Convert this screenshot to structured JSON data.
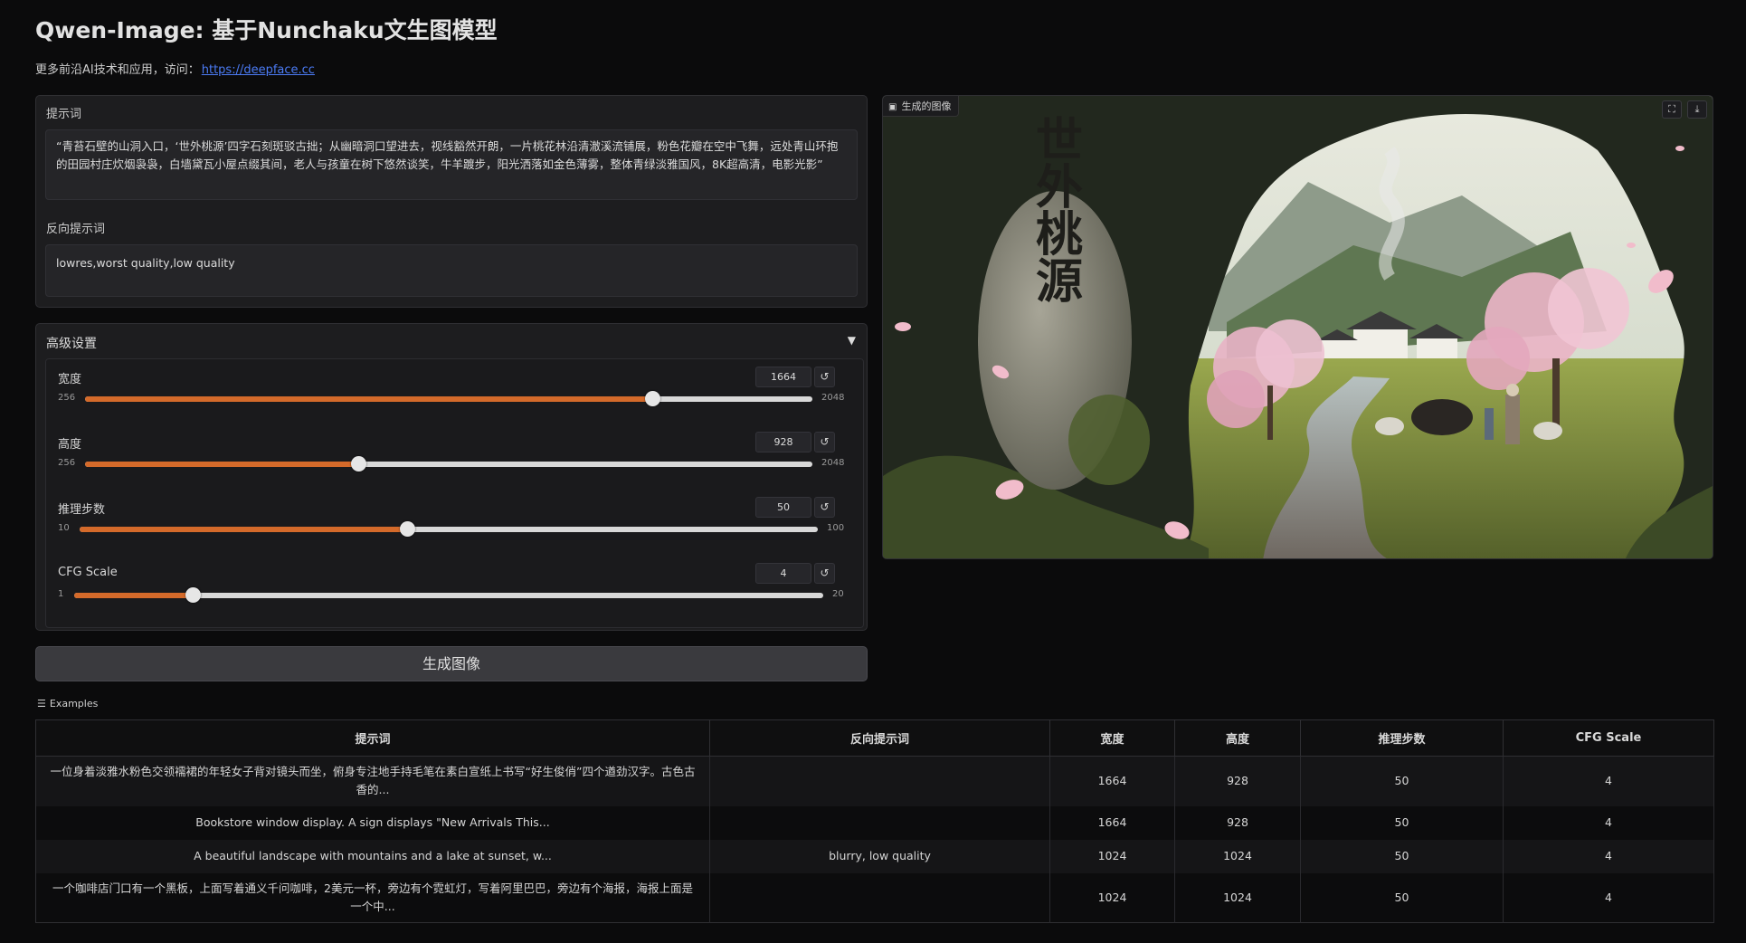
{
  "header": {
    "title": "Qwen-Image: 基于Nunchaku文生图模型",
    "subtitle_prefix": "更多前沿AI技术和应用，访问：",
    "link_text": "https://deepface.cc"
  },
  "prompt": {
    "label": "提示词",
    "value": "“青苔石壁的山洞入口，‘世外桃源’四字石刻斑驳古拙；从幽暗洞口望进去，视线豁然开朗，一片桃花林沿清澈溪流铺展，粉色花瓣在空中飞舞，远处青山环抱的田园村庄炊烟袅袅，白墙黛瓦小屋点缀其间，老人与孩童在树下悠然谈笑，牛羊踱步，阳光洒落如金色薄雾，整体青绿淡雅国风，8K超高清，电影光影”"
  },
  "negative_prompt": {
    "label": "反向提示词",
    "value": "lowres,worst quality,low quality"
  },
  "advanced": {
    "label": "高级设置",
    "caret": "▼",
    "sliders": [
      {
        "label": "宽度",
        "value": "1664",
        "min": "256",
        "max": "2048",
        "fraction": 0.78
      },
      {
        "label": "高度",
        "value": "928",
        "min": "256",
        "max": "2048",
        "fraction": 0.375
      },
      {
        "label": "推理步数",
        "value": "50",
        "min": "10",
        "max": "100",
        "fraction": 0.444
      },
      {
        "label": "CFG Scale",
        "value": "4",
        "min": "1",
        "max": "20",
        "fraction": 0.158
      }
    ],
    "reset_icon": "↺"
  },
  "generate_button": {
    "label": "生成图像"
  },
  "output": {
    "label": "生成的图像",
    "label_icon": "image-icon",
    "stone_text": "世外桃源",
    "actions": [
      {
        "name": "fullscreen-icon",
        "glyph": "⛶"
      },
      {
        "name": "download-icon",
        "glyph": "⤓"
      }
    ]
  },
  "examples": {
    "label": "Examples",
    "icon_glyph": "☰",
    "headers": [
      "提示词",
      "反向提示词",
      "宽度",
      "高度",
      "推理步数",
      "CFG Scale"
    ],
    "rows": [
      [
        "一位身着淡雅水粉色交领襦裙的年轻女子背对镜头而坐，俯身专注地手持毛笔在素白宣纸上书写“好生俊俏”四个遒劲汉字。古色古香的...",
        "",
        "1664",
        "928",
        "50",
        "4"
      ],
      [
        "Bookstore window display. A sign displays \"New Arrivals This...",
        "",
        "1664",
        "928",
        "50",
        "4"
      ],
      [
        "A beautiful landscape with mountains and a lake at sunset, w...",
        "blurry, low quality",
        "1024",
        "1024",
        "50",
        "4"
      ],
      [
        "一个咖啡店门口有一个黑板，上面写着通义千问咖啡，2美元一杯，旁边有个霓虹灯，写着阿里巴巴，旁边有个海报，海报上面是一个中...",
        "",
        "1024",
        "1024",
        "50",
        "4"
      ]
    ]
  },
  "colors": {
    "accent": "#d46a2a",
    "link": "#4b7bf5",
    "background": "#0b0b0c"
  }
}
